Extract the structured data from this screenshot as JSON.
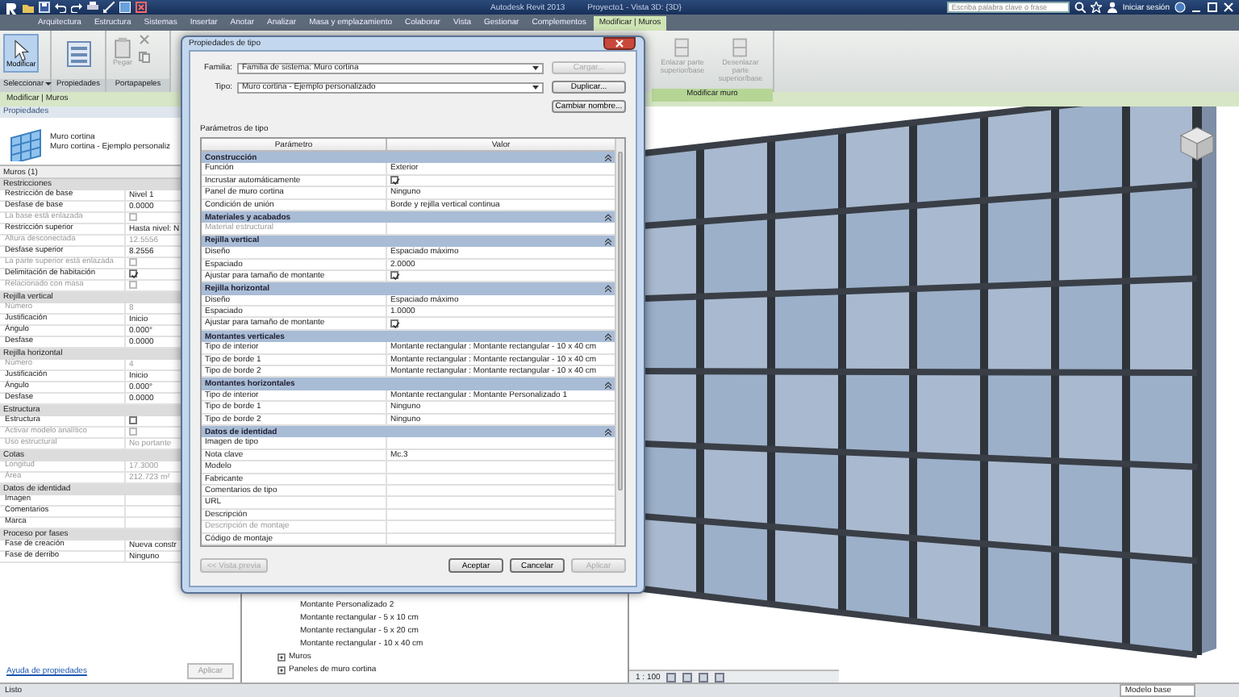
{
  "title_bar": {
    "app": "Autodesk Revit 2013",
    "document": "Proyecto1 - Vista 3D: {3D}",
    "search": {
      "placeholder": "Escriba palabra clave o frase"
    },
    "sign_in": "Iniciar sesión"
  },
  "ribbon": {
    "tabs": [
      {
        "label": "Arquitectura",
        "selected": false
      },
      {
        "label": "Estructura",
        "selected": false
      },
      {
        "label": "Sistemas",
        "selected": false
      },
      {
        "label": "Insertar",
        "selected": false
      },
      {
        "label": "Anotar",
        "selected": false
      },
      {
        "label": "Analizar",
        "selected": false
      },
      {
        "label": "Masa y emplazamiento",
        "selected": false
      },
      {
        "label": "Colaborar",
        "selected": false
      },
      {
        "label": "Vista",
        "selected": false
      },
      {
        "label": "Gestionar",
        "selected": false
      },
      {
        "label": "Complementos",
        "selected": false
      },
      {
        "label": "Modificar | Muros",
        "selected": true
      }
    ],
    "panels": [
      {
        "label": "Seleccionar",
        "kind": "select",
        "tools": [
          {
            "label": "Modificar",
            "disabled": false
          }
        ]
      },
      {
        "label": "Propiedades",
        "kind": "properties"
      },
      {
        "label": "Portapapeles",
        "kind": "clipboard",
        "tools": [
          {
            "label": "Pegar",
            "disabled": true
          }
        ]
      },
      {
        "label": "Modificar muro",
        "kind": "wall",
        "tools": [
          {
            "label": "Enlazar parte superior/base",
            "disabled": true
          },
          {
            "label": "Desenlazar parte superior/base",
            "disabled": true
          }
        ]
      }
    ]
  },
  "options_bar": "Modificar | Muros",
  "properties": {
    "title": "Propiedades",
    "type_family": "Muro cortina",
    "type_name": "Muro cortina - Ejemplo personaliz",
    "filter": "Muros (1)",
    "groups": [
      {
        "name": "Restricciones",
        "rows": [
          {
            "label": "Restricción de base",
            "kind": "text",
            "value": "Nivel 1",
            "disabled": false
          },
          {
            "label": "Desfase de base",
            "kind": "text",
            "value": "0.0000",
            "disabled": false
          },
          {
            "label": "La base está enlazada",
            "kind": "check",
            "checked": false,
            "disabled": true
          },
          {
            "label": "Restricción superior",
            "kind": "text",
            "value": "Hasta nivel: N",
            "disabled": false
          },
          {
            "label": "Altura desconectada",
            "kind": "text",
            "value": "12.5556",
            "disabled": true
          },
          {
            "label": "Desfase superior",
            "kind": "text",
            "value": "8.2556",
            "disabled": false
          },
          {
            "label": "La parte superior está enlazada",
            "kind": "check",
            "checked": false,
            "disabled": true
          },
          {
            "label": "Delimitación de habitación",
            "kind": "check",
            "checked": true,
            "disabled": false
          },
          {
            "label": "Relacionado con masa",
            "kind": "check",
            "checked": false,
            "disabled": true
          }
        ]
      },
      {
        "name": "Rejilla vertical",
        "rows": [
          {
            "label": "Número",
            "kind": "text",
            "value": "8",
            "disabled": true
          },
          {
            "label": "Justificación",
            "kind": "text",
            "value": "Inicio",
            "disabled": false
          },
          {
            "label": "Ángulo",
            "kind": "text",
            "value": "0.000°",
            "disabled": false
          },
          {
            "label": "Desfase",
            "kind": "text",
            "value": "0.0000",
            "disabled": false
          }
        ]
      },
      {
        "name": "Rejilla horizontal",
        "rows": [
          {
            "label": "Número",
            "kind": "text",
            "value": "4",
            "disabled": true
          },
          {
            "label": "Justificación",
            "kind": "text",
            "value": "Inicio",
            "disabled": false
          },
          {
            "label": "Ángulo",
            "kind": "text",
            "value": "0.000°",
            "disabled": false
          },
          {
            "label": "Desfase",
            "kind": "text",
            "value": "0.0000",
            "disabled": false
          }
        ]
      },
      {
        "name": "Estructura",
        "rows": [
          {
            "label": "Estructura",
            "kind": "check",
            "checked": false,
            "disabled": false
          },
          {
            "label": "Activar modelo analítico",
            "kind": "check",
            "checked": false,
            "disabled": true
          },
          {
            "label": "Uso estructural",
            "kind": "text",
            "value": "No portante",
            "disabled": true
          }
        ]
      },
      {
        "name": "Cotas",
        "rows": [
          {
            "label": "Longitud",
            "kind": "text",
            "value": "17.3000",
            "disabled": true
          },
          {
            "label": "Área",
            "kind": "text",
            "value": "212.723 m²",
            "disabled": true
          }
        ]
      },
      {
        "name": "Datos de identidad",
        "rows": [
          {
            "label": "Imagen",
            "kind": "empty",
            "disabled": false
          },
          {
            "label": "Comentarios",
            "kind": "empty",
            "disabled": false
          },
          {
            "label": "Marca",
            "kind": "empty",
            "disabled": false
          }
        ]
      },
      {
        "name": "Proceso por fases",
        "rows": [
          {
            "label": "Fase de creación",
            "kind": "text",
            "value": "Nueva constr",
            "disabled": false
          },
          {
            "label": "Fase de derribo",
            "kind": "text",
            "value": "Ninguno",
            "disabled": false
          }
        ]
      }
    ],
    "help_link": "Ayuda de propiedades",
    "apply": "Aplicar"
  },
  "project_browser": {
    "items": [
      {
        "label": "Montante Personalizado 2",
        "kind": "leaf"
      },
      {
        "label": "Montante rectangular - 5 x 10 cm",
        "kind": "leaf"
      },
      {
        "label": "Montante rectangular - 5 x 20 cm",
        "kind": "leaf"
      },
      {
        "label": "Montante rectangular - 10 x 40 cm",
        "kind": "leaf"
      },
      {
        "label": "Muros",
        "kind": "folder",
        "expanded": false
      },
      {
        "label": "Paneles de muro cortina",
        "kind": "folder",
        "expanded": false
      }
    ]
  },
  "view": {
    "scale": "1 : 100"
  },
  "status_bar": {
    "message": "Listo",
    "model": "Modelo base"
  },
  "dialog": {
    "title": "Propiedades de tipo",
    "family_label": "Familia:",
    "family": "Familia de sistema: Muro cortina",
    "type_label": "Tipo:",
    "type": "Muro cortina - Ejemplo personalizado",
    "side_buttons": [
      {
        "label": "Cargar...",
        "disabled": true
      },
      {
        "label": "Duplicar...",
        "disabled": false
      },
      {
        "label": "Cambiar nombre...",
        "disabled": false
      }
    ],
    "params_label": "Parámetros de tipo",
    "columns": [
      "Parámetro",
      "Valor"
    ],
    "groups": [
      {
        "name": "Construcción",
        "rows": [
          {
            "label": "Función",
            "kind": "text",
            "value": "Exterior",
            "disabled": false
          },
          {
            "label": "Incrustar automáticamente",
            "kind": "check",
            "checked": true,
            "disabled": false
          },
          {
            "label": "Panel de muro cortina",
            "kind": "text",
            "value": "Ninguno",
            "disabled": false
          },
          {
            "label": "Condición de unión",
            "kind": "text",
            "value": "Borde y rejilla vertical continua",
            "disabled": false
          }
        ]
      },
      {
        "name": "Materiales y acabados",
        "rows": [
          {
            "label": "Material estructural",
            "kind": "empty",
            "disabled": true
          }
        ]
      },
      {
        "name": "Rejilla vertical",
        "rows": [
          {
            "label": "Diseño",
            "kind": "text",
            "value": "Espaciado máximo",
            "disabled": false
          },
          {
            "label": "Espaciado",
            "kind": "text",
            "value": "2.0000",
            "disabled": false
          },
          {
            "label": "Ajustar para tamaño de montante",
            "kind": "check",
            "checked": true,
            "disabled": false
          }
        ]
      },
      {
        "name": "Rejilla horizontal",
        "rows": [
          {
            "label": "Diseño",
            "kind": "text",
            "value": "Espaciado máximo",
            "disabled": false
          },
          {
            "label": "Espaciado",
            "kind": "text",
            "value": "1.0000",
            "disabled": false
          },
          {
            "label": "Ajustar para tamaño de montante",
            "kind": "check",
            "checked": true,
            "disabled": false
          }
        ]
      },
      {
        "name": "Montantes verticales",
        "rows": [
          {
            "label": "Tipo de interior",
            "kind": "text",
            "value": "Montante rectangular : Montante rectangular - 10 x 40 cm",
            "disabled": false
          },
          {
            "label": "Tipo de borde 1",
            "kind": "text",
            "value": "Montante rectangular : Montante rectangular - 10 x 40 cm",
            "disabled": false
          },
          {
            "label": "Tipo de borde 2",
            "kind": "text",
            "value": "Montante rectangular : Montante rectangular - 10 x 40 cm",
            "disabled": false
          }
        ]
      },
      {
        "name": "Montantes horizontales",
        "rows": [
          {
            "label": "Tipo de interior",
            "kind": "text",
            "value": "Montante rectangular : Montante Personalizado 1",
            "disabled": false
          },
          {
            "label": "Tipo de borde 1",
            "kind": "text",
            "value": "Ninguno",
            "disabled": false
          },
          {
            "label": "Tipo de borde 2",
            "kind": "text",
            "value": "Ninguno",
            "disabled": false
          }
        ]
      },
      {
        "name": "Datos de identidad",
        "rows": [
          {
            "label": "Imagen de tipo",
            "kind": "empty",
            "disabled": false
          },
          {
            "label": "Nota clave",
            "kind": "text",
            "value": "Mc.3",
            "disabled": false
          },
          {
            "label": "Modelo",
            "kind": "empty",
            "disabled": false
          },
          {
            "label": "Fabricante",
            "kind": "empty",
            "disabled": false
          },
          {
            "label": "Comentarios de tipo",
            "kind": "empty",
            "disabled": false
          },
          {
            "label": "URL",
            "kind": "empty",
            "disabled": false
          },
          {
            "label": "Descripción",
            "kind": "empty",
            "disabled": false
          },
          {
            "label": "Descripción de montaje",
            "kind": "empty",
            "disabled": true
          },
          {
            "label": "Código de montaje",
            "kind": "empty",
            "disabled": false
          }
        ]
      }
    ],
    "preview": "<< Vista previa",
    "buttons": [
      {
        "label": "Aceptar",
        "disabled": false
      },
      {
        "label": "Cancelar",
        "disabled": false
      },
      {
        "label": "Aplicar",
        "disabled": true
      }
    ]
  }
}
